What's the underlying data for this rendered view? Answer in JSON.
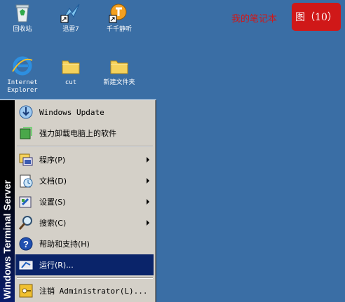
{
  "desktop": {
    "icons": [
      {
        "name": "recycle-bin",
        "label": "回收站"
      },
      {
        "name": "xunlei",
        "label": "迅雷7"
      },
      {
        "name": "ttplayer",
        "label": "千千静听"
      },
      {
        "name": "internet-explorer",
        "label": "Internet\nExplorer"
      },
      {
        "name": "folder-cut",
        "label": "cut"
      },
      {
        "name": "new-folder",
        "label": "新建文件夹"
      }
    ]
  },
  "watermark": "我的笔记本",
  "figure_badge": "图（10）",
  "start_menu": {
    "banner": "Windows Terminal Server",
    "top_items": [
      {
        "label": "Windows Update",
        "icon": "windows-update-icon"
      },
      {
        "label": "强力卸载电脑上的软件",
        "icon": "uninstall-icon"
      }
    ],
    "items": [
      {
        "label": "程序(P)",
        "icon": "programs-icon",
        "submenu": true
      },
      {
        "label": "文档(D)",
        "icon": "documents-icon",
        "submenu": true
      },
      {
        "label": "设置(S)",
        "icon": "settings-icon",
        "submenu": true
      },
      {
        "label": "搜索(C)",
        "icon": "search-icon",
        "submenu": true
      },
      {
        "label": "帮助和支持(H)",
        "icon": "help-icon",
        "submenu": false
      },
      {
        "label": "运行(R)...",
        "icon": "run-icon",
        "submenu": false,
        "selected": true
      }
    ],
    "bottom_items": [
      {
        "label": "注销 Administrator(L)...",
        "icon": "logoff-icon"
      }
    ]
  }
}
